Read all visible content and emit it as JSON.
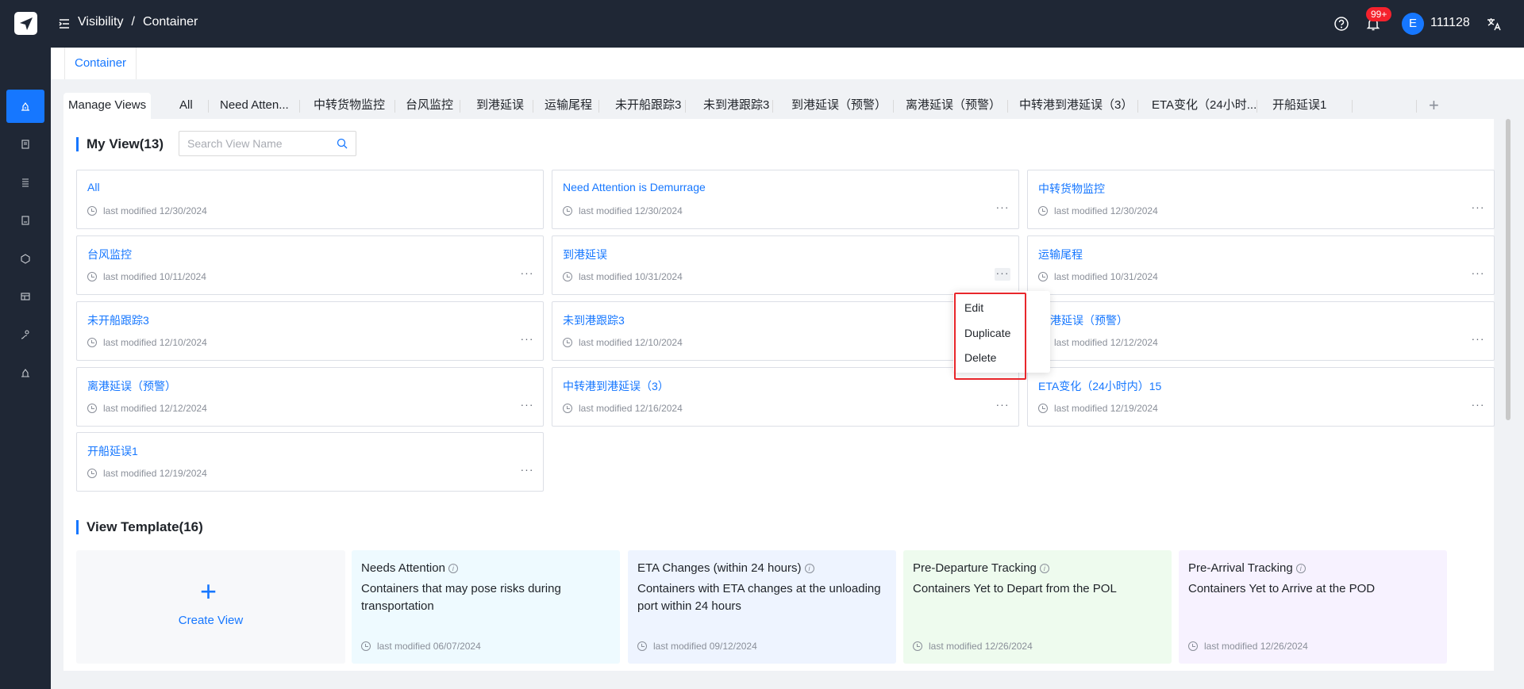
{
  "header": {
    "breadcrumb": [
      "Visibility",
      "Container"
    ],
    "notification_badge": "99+",
    "avatar_initial": "E",
    "username": "111128"
  },
  "page_tab": "Container",
  "view_tabs": [
    "Manage Views",
    "All",
    "Need Atten...",
    "中转货物监控",
    "台风监控",
    "到港延误",
    "运输尾程",
    "未开船跟踪3",
    "未到港跟踪3",
    "到港延误（预警）",
    "离港延误（预警）",
    "中转港到港延误（3）",
    "ETA变化（24小时...",
    "开船延误1"
  ],
  "my_view": {
    "title": "My View(13)",
    "search_placeholder": "Search View Name",
    "views": [
      {
        "name": "All",
        "modified": "last modified 12/30/2024"
      },
      {
        "name": "Need Attention is Demurrage",
        "modified": "last modified 12/30/2024"
      },
      {
        "name": "中转货物监控",
        "modified": "last modified 12/30/2024"
      },
      {
        "name": "台风监控",
        "modified": "last modified 10/11/2024"
      },
      {
        "name": "到港延误",
        "modified": "last modified 10/31/2024"
      },
      {
        "name": "运输尾程",
        "modified": "last modified 10/31/2024"
      },
      {
        "name": "未开船跟踪3",
        "modified": "last modified 12/10/2024"
      },
      {
        "name": "未到港跟踪3",
        "modified": "last modified 12/10/2024"
      },
      {
        "name": "港延误（预警）",
        "modified": "last modified 12/12/2024"
      },
      {
        "name": "离港延误（预警）",
        "modified": "last modified 12/12/2024"
      },
      {
        "name": "中转港到港延误（3）",
        "modified": "last modified 12/16/2024"
      },
      {
        "name": "ETA变化（24小时内）15",
        "modified": "last modified 12/19/2024"
      },
      {
        "name": "开船延误1",
        "modified": "last modified 12/19/2024"
      }
    ],
    "more_label": "···"
  },
  "dropdown": {
    "items": [
      "Edit",
      "Duplicate",
      "Delete"
    ]
  },
  "view_template": {
    "title": "View Template(16)",
    "create_label": "Create View",
    "templates": [
      {
        "title": "Needs Attention",
        "desc": "Containers that may pose risks during transportation",
        "modified": "last modified 06/07/2024",
        "bg": "#eefaff"
      },
      {
        "title": "ETA Changes (within 24 hours)",
        "desc": "Containers with ETA changes at the unloading port within 24 hours",
        "modified": "last modified 09/12/2024",
        "bg": "#eef4ff"
      },
      {
        "title": "Pre-Departure Tracking",
        "desc": "Containers Yet to Depart from the POL",
        "modified": "last modified 12/26/2024",
        "bg": "#eefbee"
      },
      {
        "title": "Pre-Arrival Tracking",
        "desc": "Containers Yet to Arrive at the POD",
        "modified": "last modified 12/26/2024",
        "bg": "#f7f2ff"
      }
    ]
  },
  "colors": {
    "topbar": "#1f2735",
    "accent": "#1677ff",
    "highlight": "#e8262b"
  }
}
